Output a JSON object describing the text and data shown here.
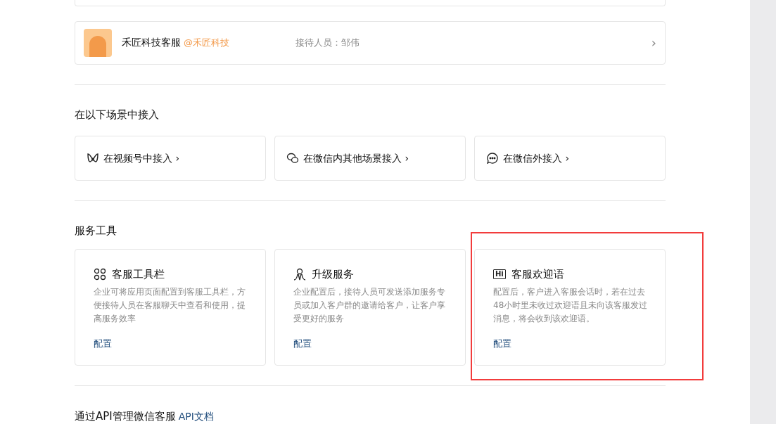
{
  "account": {
    "name": "禾匠科技客服",
    "handle": "@禾匠科技",
    "staff": "接待人员：邹伟",
    "chevron": "›"
  },
  "scenes": {
    "title": "在以下场景中接入",
    "items": [
      {
        "kind": "channels",
        "label": "在视频号中接入 ›"
      },
      {
        "kind": "wechat",
        "label": "在微信内其他场景接入 ›"
      },
      {
        "kind": "chat",
        "label": "在微信外接入 ›"
      }
    ]
  },
  "tools": {
    "title": "服务工具",
    "items": [
      {
        "kind": "grid",
        "title": "客服工具栏",
        "description": "企业可将应用页面配置到客服工具栏，方便接待人员在客服聊天中查看和使用，提高服务效率",
        "action": "配置",
        "highlighted": false
      },
      {
        "kind": "person",
        "title": "升级服务",
        "description": "企业配置后，接待人员可发送添加服务专员或加入客户群的邀请给客户，让客户享受更好的服务",
        "action": "配置",
        "highlighted": false
      },
      {
        "kind": "hi",
        "icon_text": "Hi",
        "title": "客服欢迎语",
        "description": "配置后，客户进入客服会话时，若在过去48小时里未收过欢迎语且未向该客服发过消息，将会收到该欢迎语。",
        "action": "配置",
        "highlighted": true
      }
    ]
  },
  "api": {
    "title": "通过API管理微信客服",
    "link": "API文档"
  }
}
